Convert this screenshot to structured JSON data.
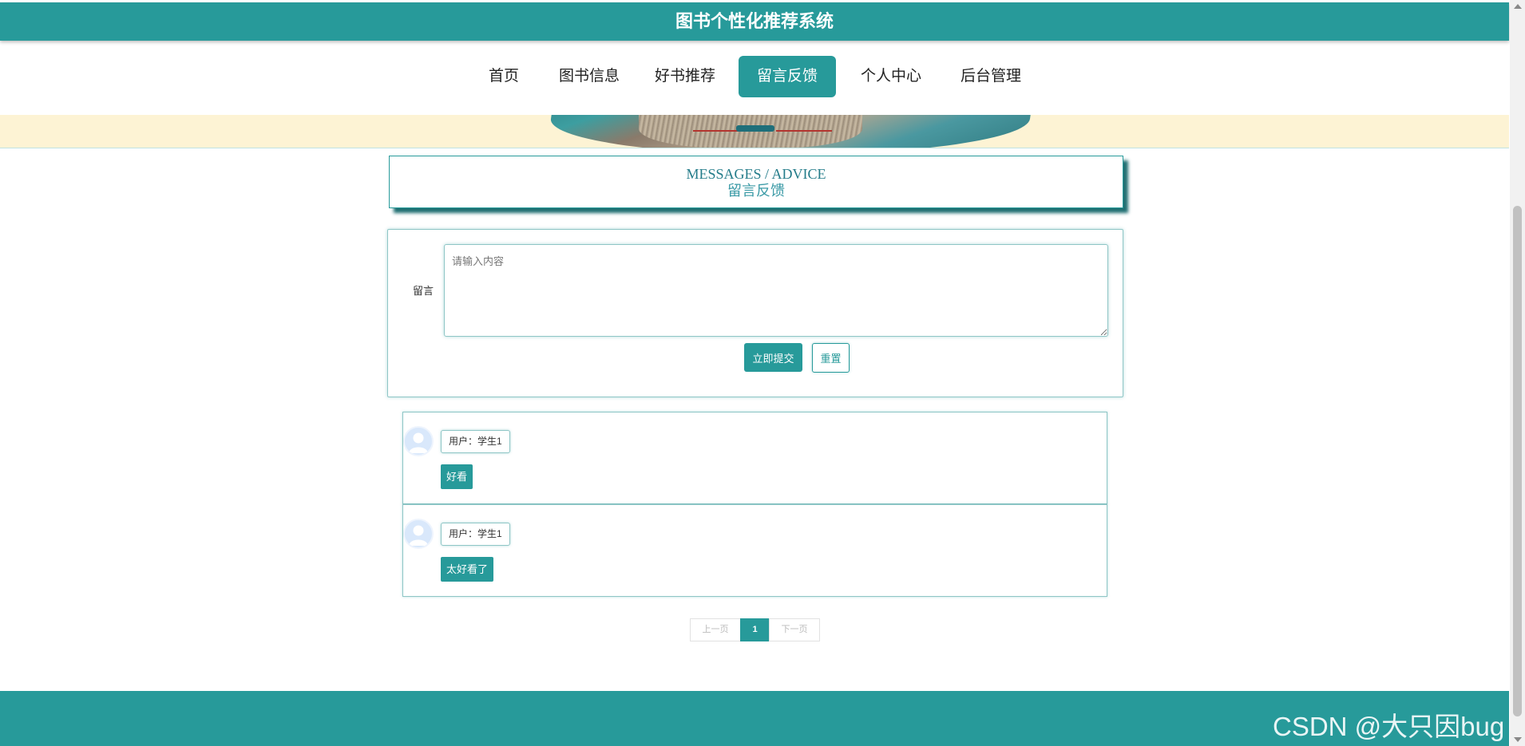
{
  "app": {
    "title": "图书个性化推荐系统"
  },
  "nav": {
    "items": [
      {
        "label": "首页",
        "active": false
      },
      {
        "label": "图书信息",
        "active": false
      },
      {
        "label": "好书推荐",
        "active": false
      },
      {
        "label": "留言反馈",
        "active": true
      },
      {
        "label": "个人中心",
        "active": false
      },
      {
        "label": "后台管理",
        "active": false
      }
    ]
  },
  "section": {
    "title_en": "MESSAGES / ADVICE",
    "title_zh": "留言反馈"
  },
  "form": {
    "label": "留言",
    "placeholder": "请输入内容",
    "value": "",
    "submit_label": "立即提交",
    "reset_label": "重置"
  },
  "comments": [
    {
      "user": "用户：学生1",
      "content": "好看",
      "avatar_icon": "user-avatar-icon"
    },
    {
      "user": "用户：学生1",
      "content": "太好看了",
      "avatar_icon": "user-avatar-icon"
    }
  ],
  "pagination": {
    "prev_label": "上一页",
    "current_page": "1",
    "next_label": "下一页"
  },
  "watermark": "CSDN @大只因bug",
  "colors": {
    "accent": "#279a9a",
    "banner_bg": "#fdf3d4",
    "heading_text": "#247c8a"
  }
}
